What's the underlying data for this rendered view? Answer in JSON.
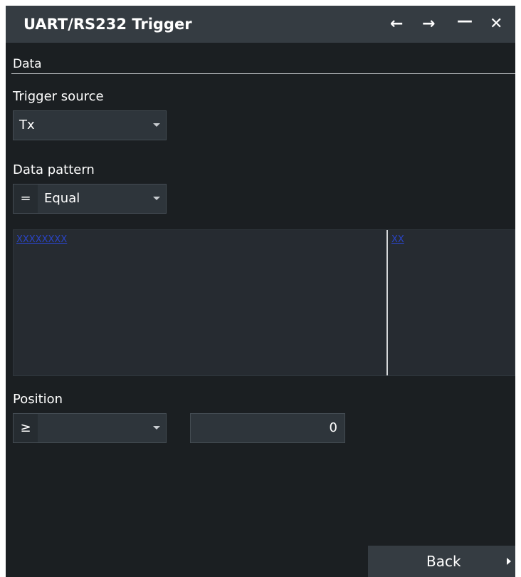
{
  "window": {
    "title": "UART/RS232 Trigger",
    "icons": [
      "back-arrow-icon",
      "forward-arrow-icon",
      "minimize-icon",
      "close-icon"
    ]
  },
  "section": {
    "label": "Data"
  },
  "trigger_source": {
    "label": "Trigger source",
    "value": "Tx"
  },
  "data_pattern": {
    "label": "Data pattern",
    "symbol": "=",
    "value": "Equal"
  },
  "pattern_editor": {
    "bits_binary": "XXXXXXXX",
    "bits_hex": "XX"
  },
  "position": {
    "label": "Position",
    "operator": "≥",
    "value": "0"
  },
  "footer": {
    "back_label": "Back"
  }
}
